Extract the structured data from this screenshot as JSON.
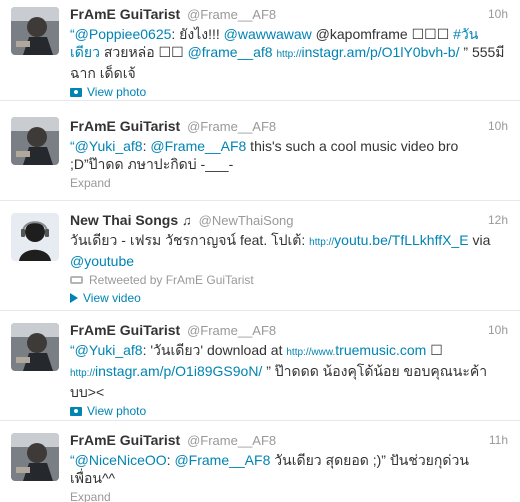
{
  "tweets": [
    {
      "name": "FrAmE GuiTarist",
      "handle": "@Frame__AF8",
      "time": "10h",
      "text": {
        "mention1": "“@Poppiee0625",
        "t1": ": ยังไง!!! ",
        "mention2": "@wawwawaw",
        "t2": " @kapomframe ☐☐☐ ",
        "hashtag": "#วันเดียว",
        "t3": " สวยหล่อ ☐☐ ",
        "mention3": "@frame__af8",
        "link_prefix": "http://",
        "link": "instagr.am/p/O1lY0bvh-b/",
        "t4": " ” 555มีฉาก เด็ดเจ้"
      },
      "action_label": "View photo"
    },
    {
      "name": "FrAmE GuiTarist",
      "handle": "@Frame__AF8",
      "time": "10h",
      "text": {
        "mention1": "“@Yuki_af8",
        "t1": ": ",
        "mention2": "@Frame__AF8",
        "t2": " this's such a cool music video bro ;D”ป๊าดด ภษาปะกิดบ่ -___-"
      },
      "action_label": "Expand"
    },
    {
      "name": "New Thai Songs",
      "name_icon": "♫",
      "handle": "@NewThaiSong",
      "time": "12h",
      "text": {
        "t1": "วันเดียว - เฟรม วัชรกาญจน์ feat. โปเต้: ",
        "link_prefix": "http://",
        "link": "youtu.be/TfLLkhffX_E",
        "t2": "  via ",
        "mention1": "@youtube"
      },
      "retweeted_by": "Retweeted by FrAmE GuiTarist",
      "action_label": "View video"
    },
    {
      "name": "FrAmE GuiTarist",
      "handle": "@Frame__AF8",
      "time": "10h",
      "text": {
        "mention1": "“@Yuki_af8",
        "t1": ": 'วันเดียว' download at ",
        "link1_prefix": "http://www.",
        "link1": "truemusic.com",
        "t2": "  ☐ ",
        "link2_prefix": "http://",
        "link2": "instagr.am/p/O1i89GS9oN/",
        "t3": " ” ป๊าดดด น้องคุโด้น้อย ขอบคุณนะค้า บบ><"
      },
      "action_label": "View photo"
    },
    {
      "name": "FrAmE GuiTarist",
      "handle": "@Frame__AF8",
      "time": "11h",
      "text": {
        "mention1": "“@NiceNiceOO",
        "t1": ": ",
        "mention2": "@Frame__AF8",
        "t2": " วันเดียว สุดยอด ;)” ปันช่วยกุด่วนเพื่อน^^"
      },
      "action_label": "Expand"
    }
  ],
  "colors": {
    "link": "#0084b4",
    "muted": "#999999",
    "text": "#333333"
  },
  "icons": {
    "photo": "photo-icon",
    "video": "play-icon",
    "retweet": "retweet-icon",
    "music": "music-note-icon"
  }
}
